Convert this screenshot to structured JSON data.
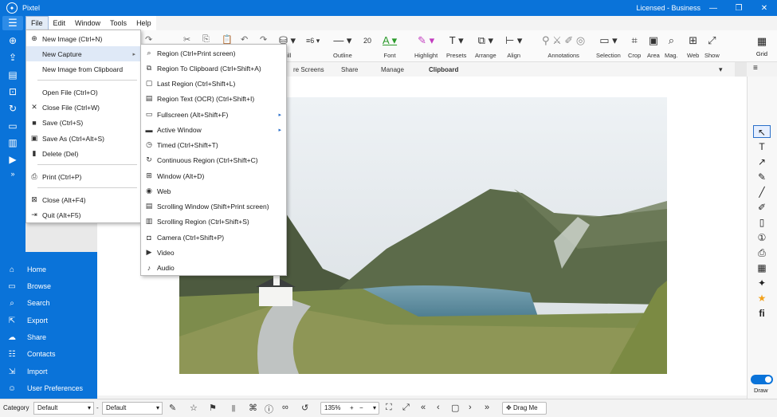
{
  "app": {
    "title": "Pixtel",
    "license": "Licensed - Business"
  },
  "menubar": [
    "File",
    "Edit",
    "Window",
    "Tools",
    "Help"
  ],
  "toolbar": {
    "font_size": "6",
    "font_px": "20",
    "labels": [
      "Fill",
      "Outline",
      "Font",
      "Highlight",
      "Presets",
      "Arrange",
      "Align",
      "Annotations",
      "Selection",
      "Crop",
      "Area",
      "Mag.",
      "Web",
      "Show",
      "Grid"
    ]
  },
  "tabs": [
    "re Screens",
    "Share",
    "Manage",
    "Clipboard"
  ],
  "nav": [
    "Home",
    "Browse",
    "Search",
    "Export",
    "Share",
    "Contacts",
    "Import",
    "User Preferences"
  ],
  "file_menu": [
    {
      "label": "New Image (Ctrl+N)",
      "icon": "plus-circle-icon"
    },
    {
      "label": "New Capture",
      "icon": "",
      "submenu": true
    },
    {
      "label": "New Image from Clipboard",
      "icon": ""
    },
    {
      "label": "Open File (Ctrl+O)",
      "icon": ""
    },
    {
      "label": "Close File (Ctrl+W)",
      "icon": "close-icon"
    },
    {
      "label": "Save (Ctrl+S)",
      "icon": "save-icon"
    },
    {
      "label": "Save As (Ctrl+Alt+S)",
      "icon": "save-as-icon"
    },
    {
      "label": "Delete (Del)",
      "icon": "trash-icon"
    },
    {
      "label": "Print (Ctrl+P)",
      "icon": "print-icon"
    },
    {
      "label": "Close (Alt+F4)",
      "icon": "close-box-icon"
    },
    {
      "label": "Quit (Alt+F5)",
      "icon": "quit-icon"
    }
  ],
  "capture_menu": [
    "Region (Ctrl+Print screen)",
    "Region To Clipboard (Ctrl+Shift+A)",
    "Last Region (Ctrl+Shift+L)",
    "Region Text (OCR) (Ctrl+Shift+I)",
    "Fullscreen (Alt+Shift+F)",
    "Active Window",
    "Timed (Ctrl+Shift+T)",
    "Continuous Region (Ctrl+Shift+C)",
    "Window (Alt+D)",
    "Web",
    "Scrolling Window (Shift+Print screen)",
    "Scrolling Region (Ctrl+Shift+S)",
    "Camera (Ctrl+Shift+P)",
    "Video",
    "Audio"
  ],
  "right_panel": {
    "draw_label": "Draw"
  },
  "bottombar": {
    "category_label": "Category",
    "category_value": "Default",
    "second_value": "Default",
    "zoom": "135%",
    "drag_label": "Drag Me"
  }
}
